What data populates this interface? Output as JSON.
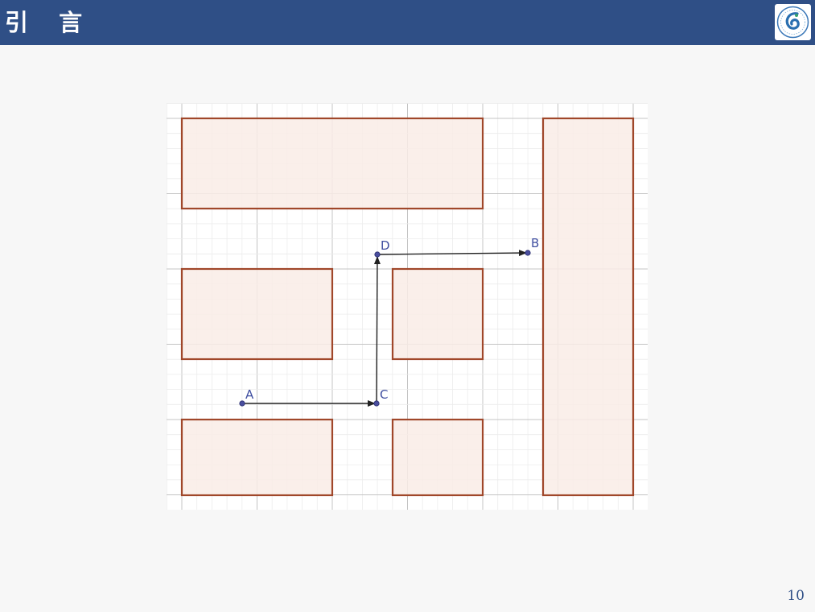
{
  "slide": {
    "title": "引 言",
    "page_number": "10"
  },
  "colors": {
    "header_bg": "#2f4f86",
    "obstacle_fill": "#f9ece6",
    "obstacle_stroke": "#a0472a",
    "grid_minor": "#ececec",
    "grid_major": "#c4c4c4",
    "point": "#4a4e9e",
    "label": "#3f4ea0",
    "arrow": "#222222"
  },
  "diagram": {
    "points": [
      {
        "label": "A"
      },
      {
        "label": "C"
      },
      {
        "label": "D"
      },
      {
        "label": "B"
      }
    ],
    "paths": [
      {
        "from": "A",
        "to": "C"
      },
      {
        "from": "C",
        "to": "D"
      },
      {
        "from": "D",
        "to": "B"
      }
    ]
  }
}
